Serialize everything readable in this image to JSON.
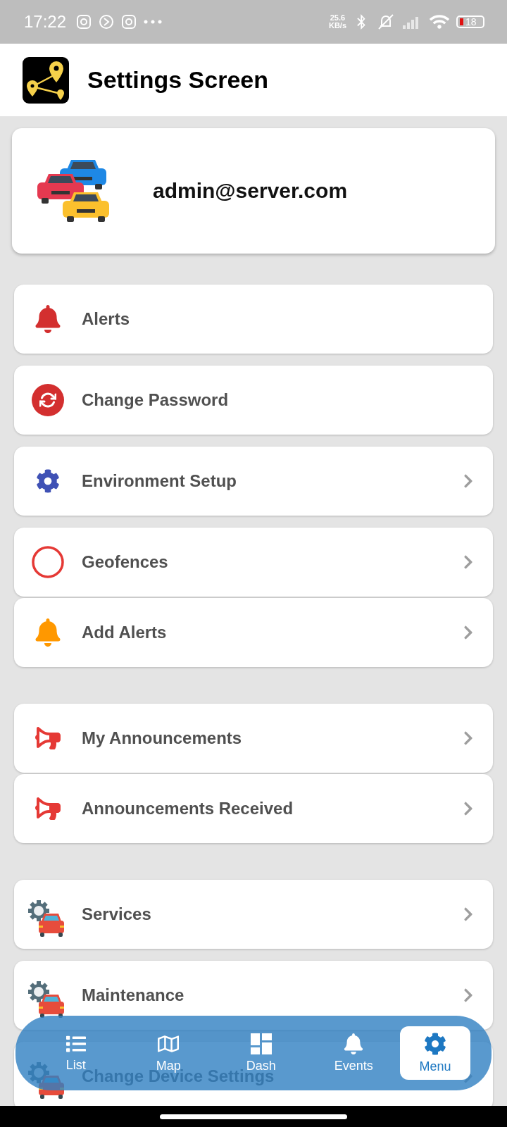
{
  "status_bar": {
    "time": "17:22",
    "speed_value": "25.6",
    "speed_unit": "KB/s",
    "battery": "18"
  },
  "header": {
    "title": "Settings Screen"
  },
  "profile": {
    "email": "admin@server.com"
  },
  "sections": [
    {
      "groups": [
        {
          "items": [
            {
              "kind": "bell",
              "label": "Alerts",
              "color": "#d32f2f",
              "chevron": false
            }
          ]
        },
        {
          "items": [
            {
              "kind": "refresh",
              "label": "Change Password",
              "color": "#d32f2f",
              "chevron": false
            }
          ]
        },
        {
          "items": [
            {
              "kind": "gear",
              "label": "Environment Setup",
              "color": "#3f51b5",
              "chevron": true
            }
          ]
        },
        {
          "items": [
            {
              "kind": "ring",
              "label": "Geofences",
              "color": "#e53935",
              "chevron": true
            },
            {
              "kind": "bell",
              "label": "Add Alerts",
              "color": "#ff9800",
              "chevron": true
            }
          ]
        }
      ]
    },
    {
      "groups": [
        {
          "items": [
            {
              "kind": "megaphone",
              "label": "My Announcements",
              "color": "#e53935",
              "chevron": true
            },
            {
              "kind": "megaphone",
              "label": "Announcements Received",
              "color": "#e53935",
              "chevron": true
            }
          ]
        }
      ]
    },
    {
      "groups": [
        {
          "items": [
            {
              "kind": "car-service",
              "label": "Services",
              "color": "#e74c3c",
              "chevron": true
            }
          ]
        },
        {
          "items": [
            {
              "kind": "car-service",
              "label": "Maintenance",
              "color": "#e74c3c",
              "chevron": true
            }
          ]
        },
        {
          "items": [
            {
              "kind": "car-service",
              "label": "Change Device Settings",
              "color": "#e74c3c",
              "chevron": true
            }
          ]
        }
      ]
    }
  ],
  "bottom_nav": [
    {
      "kind": "list",
      "label": "List",
      "selected": false
    },
    {
      "kind": "map",
      "label": "Map",
      "selected": false
    },
    {
      "kind": "dash",
      "label": "Dash",
      "selected": false
    },
    {
      "kind": "bell",
      "label": "Events",
      "selected": false
    },
    {
      "kind": "gear",
      "label": "Menu",
      "selected": true
    }
  ]
}
